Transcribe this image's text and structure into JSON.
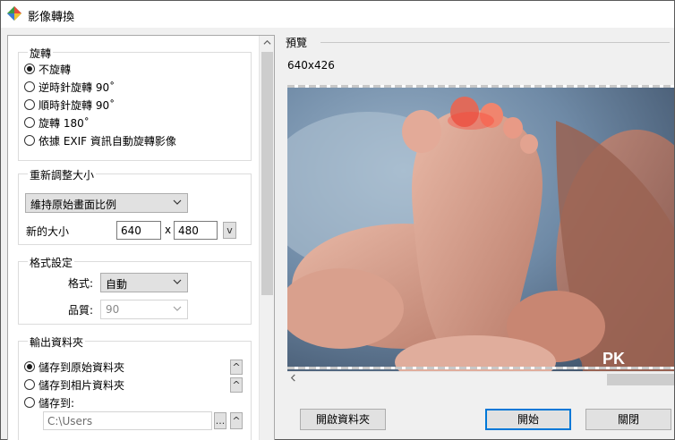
{
  "window": {
    "title": "影像轉換"
  },
  "rotation": {
    "title": "旋轉",
    "options": [
      {
        "label": "不旋轉",
        "checked": true
      },
      {
        "label": "逆時針旋轉 90˚",
        "checked": false
      },
      {
        "label": "順時針旋轉 90˚",
        "checked": false
      },
      {
        "label": "旋轉 180˚",
        "checked": false
      },
      {
        "label": "依據 EXIF 資訊自動旋轉影像",
        "checked": false
      }
    ]
  },
  "resize": {
    "title": "重新調整大小",
    "mode": "維持原始畫面比例",
    "size_label": "新的大小",
    "width": "640",
    "separator": "x",
    "height": "480",
    "unit_button": "v"
  },
  "format": {
    "title": "格式設定",
    "format_label": "格式:",
    "format_value": "自動",
    "quality_label": "品質:",
    "quality_value": "90"
  },
  "output": {
    "title": "輸出資料夾",
    "options": [
      {
        "label": "儲存到原始資料夾",
        "checked": true
      },
      {
        "label": "儲存到相片資料夾",
        "checked": false
      },
      {
        "label": "儲存到:",
        "checked": false
      }
    ],
    "path": "C:\\Users",
    "browse_label": "...",
    "up_label": "^"
  },
  "preview": {
    "title": "預覽",
    "dimensions": "640x426",
    "watermark": "PK"
  },
  "buttons": {
    "open_folder": "開啟資料夾",
    "start": "開始",
    "close": "關閉"
  },
  "colors": {
    "default_button_border": "#0078d7",
    "scrollbar_thumb": "#cdcdcd"
  }
}
